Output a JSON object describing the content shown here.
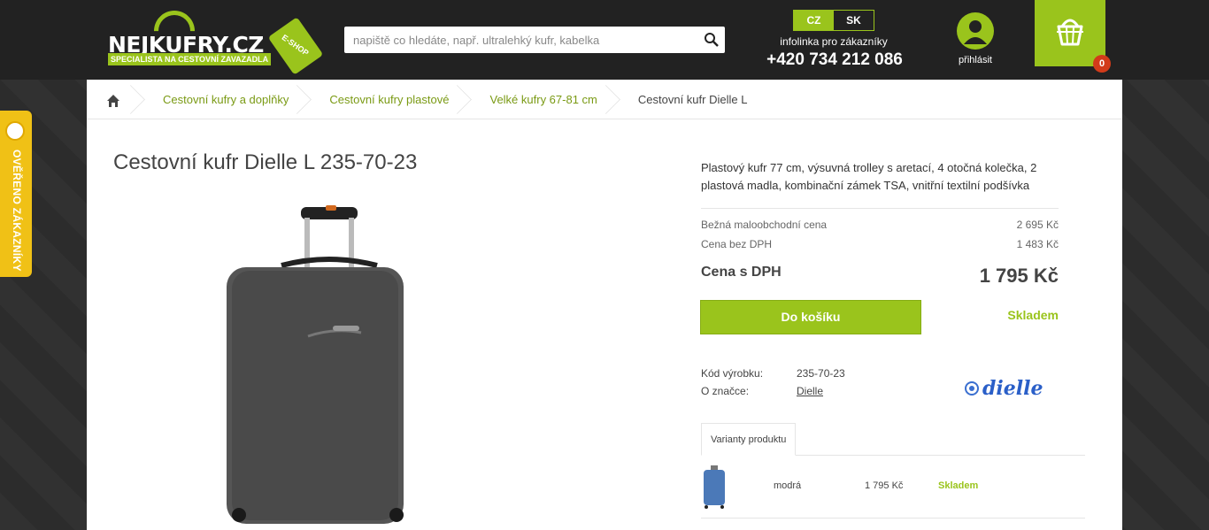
{
  "header": {
    "logo_text": "NEJKUFRY.CZ",
    "logo_subtitle": "SPECIALISTA NA CESTOVNÍ ZAVAZADLA",
    "logo_tag": "E-SHOP",
    "search_placeholder": "napiště co hledáte, např. ultralehký kufr, kabelka",
    "lang_cz": "CZ",
    "lang_sk": "SK",
    "infolinka": "infolinka pro zákazníky",
    "phone": "+420 734 212 086",
    "login_label": "přihlásit",
    "cart_count": "0"
  },
  "side_badge": {
    "label": "OVĚŘENO ZÁKAZNÍKY"
  },
  "breadcrumb": {
    "items": [
      "Cestovní kufry a doplňky",
      "Cestovní kufry plastové",
      "Velké kufry 67-81 cm"
    ],
    "current": "Cestovní kufr Dielle L"
  },
  "product": {
    "title": "Cestovní kufr Dielle L 235-70-23",
    "description": "Plastový kufr 77 cm, výsuvná trolley s aretací, 4 otočná kolečka, 2 plastová madla, kombinační zámek TSA, vnitřní textilní podšívka",
    "retail_label": "Bežná maloobchodní cena",
    "retail_price": "2 695 Kč",
    "no_vat_label": "Cena bez DPH",
    "no_vat_price": "1 483 Kč",
    "vat_label": "Cena s DPH",
    "vat_price": "1 795 Kč",
    "add_to_cart": "Do košíku",
    "stock": "Skladem",
    "code_label": "Kód výrobku:",
    "code_value": "235-70-23",
    "brand_label": "O značce:",
    "brand_value": "Dielle",
    "brand_logo": "dielle"
  },
  "variants": {
    "tab_label": "Varianty produktu",
    "items": [
      {
        "color": "modrá",
        "price": "1 795 Kč",
        "stock": "Skladem"
      }
    ]
  },
  "colors": {
    "accent": "#9ac41c",
    "header_bg": "#222222",
    "badge": "#f0c116",
    "cart_badge": "#d23b1a"
  }
}
